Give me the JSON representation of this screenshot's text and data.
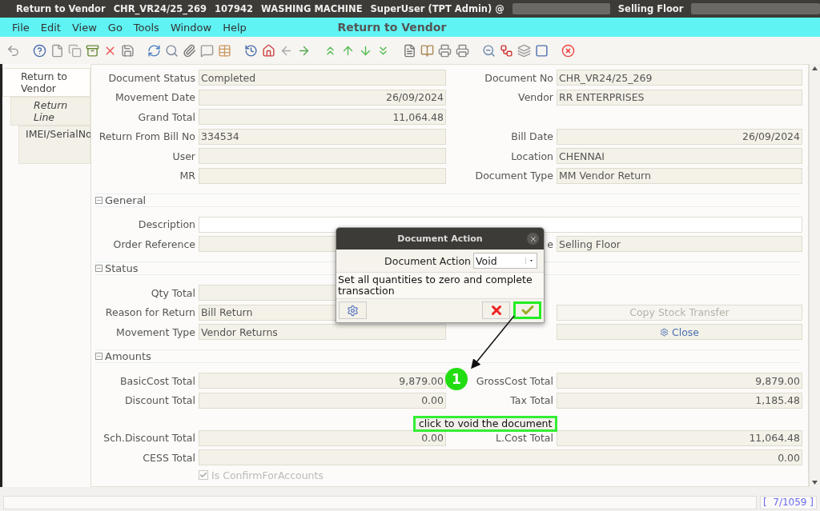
{
  "title_bar": {
    "segments": [
      "Return to Vendor",
      "CHR_VR24/25_269",
      "107942",
      "WASHING MACHINE",
      "SuperUser (TPT Admin) @"
    ],
    "location": "Selling Floor"
  },
  "menu": [
    "File",
    "Edit",
    "View",
    "Go",
    "Tools",
    "Window",
    "Help"
  ],
  "window_title": "Return to Vendor",
  "tabs": [
    {
      "label": "Return to Vendor",
      "selected": true,
      "children": [
        {
          "label": "Return Line",
          "selected": false,
          "children": [
            {
              "label": "IMEI/SerialNo",
              "selected": false
            }
          ]
        }
      ]
    }
  ],
  "header_rows": [
    {
      "kind": "pair",
      "left": {
        "label": "Document Status",
        "value": "Completed",
        "numeric": false
      },
      "right": {
        "label": "Document No",
        "value": "CHR_VR24/25_269",
        "numeric": false
      }
    },
    {
      "kind": "pair",
      "left": {
        "label": "Movement Date",
        "value": "26/09/2024",
        "numeric": true
      },
      "right": {
        "label": "Vendor",
        "value": "RR ENTERPRISES",
        "numeric": false
      }
    },
    {
      "kind": "pair",
      "left": {
        "label": "Grand Total",
        "value": "11,064.48",
        "numeric": true
      }
    },
    {
      "kind": "pair",
      "left": {
        "label": "Return From Bill No",
        "value": "334534",
        "numeric": false
      },
      "right": {
        "label": "Bill Date",
        "value": "26/09/2024",
        "numeric": true
      }
    },
    {
      "kind": "pair",
      "left": {
        "label": "User"
      },
      "right": {
        "label": "Location",
        "value": "CHENNAI",
        "numeric": false
      }
    },
    {
      "kind": "pair",
      "left": {
        "label": "MR"
      },
      "right": {
        "label": "Document Type",
        "value": "MM Vendor Return",
        "numeric": false
      }
    }
  ],
  "sections": [
    {
      "title": "General",
      "expanded": true,
      "rows": [
        {
          "kind": "wide",
          "field": {
            "label": "Description",
            "editable": true
          }
        },
        {
          "kind": "pair",
          "left": {
            "label": "Order Reference"
          },
          "right": {
            "label": "e",
            "value": "Selling Floor",
            "numeric": false
          }
        }
      ]
    },
    {
      "title": "Status",
      "expanded": true,
      "rows": [
        {
          "kind": "pair",
          "left": {
            "label": "Qty Total"
          }
        },
        {
          "kind": "pair",
          "left": {
            "label": "Reason for Return",
            "value": "Bill Return",
            "numeric": false
          },
          "right": {
            "kind": "button",
            "label": "Copy Stock Transfer",
            "disabled": true
          }
        },
        {
          "kind": "pair",
          "left": {
            "label": "Movement Type",
            "value": "Vendor Returns",
            "numeric": false
          },
          "right": {
            "kind": "button",
            "label": "Close",
            "disabled": false
          }
        }
      ]
    },
    {
      "title": "Amounts",
      "expanded": true,
      "rows": [
        {
          "kind": "pair",
          "left": {
            "label": "BasicCost Total",
            "value": "9,879.00",
            "numeric": true
          },
          "right": {
            "label": "GrossCost Total",
            "value": "9,879.00",
            "numeric": true
          }
        },
        {
          "kind": "pair",
          "left": {
            "label": "Discount Total",
            "value": "0.00",
            "numeric": true
          },
          "right": {
            "label": "Tax Total",
            "value": "1,185.48",
            "numeric": true
          }
        },
        {
          "kind": "pair",
          "left": {
            "label": "Sch.Discount Total",
            "value": "0.00",
            "numeric": true
          },
          "right": {
            "label": "L.Cost Total",
            "value": "11,064.48",
            "numeric": true
          }
        },
        {
          "kind": "wide",
          "field": {
            "label": "CESS Total",
            "value": "0.00",
            "numeric": true,
            "editable": false
          }
        },
        {
          "kind": "checkbox",
          "label": "Is ConfirmForAccounts",
          "checked": true,
          "disabled": true
        }
      ]
    }
  ],
  "dialog": {
    "title": "Document Action",
    "field_label": "Document Action",
    "value": "Void",
    "description": "Set all quantities to zero and complete transaction"
  },
  "annotation": {
    "number": "1",
    "text": "click to void the document"
  },
  "status_bar": {
    "record": "[  7/1059 ]"
  }
}
